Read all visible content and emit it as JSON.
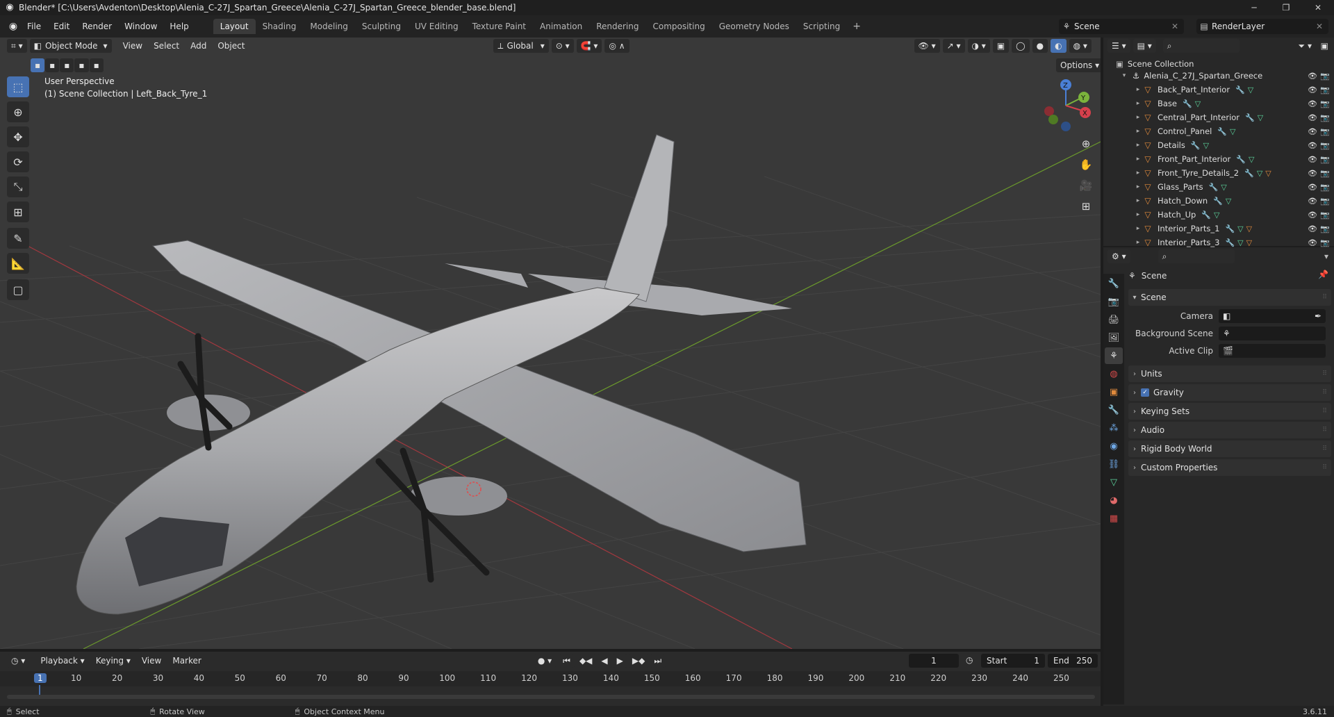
{
  "titlebar": {
    "title": "Blender* [C:\\Users\\Avdenton\\Desktop\\Alenia_C-27J_Spartan_Greece\\Alenia_C-27J_Spartan_Greece_blender_base.blend]",
    "min": "─",
    "max": "❐",
    "close": "✕"
  },
  "menu": [
    "File",
    "Edit",
    "Render",
    "Window",
    "Help"
  ],
  "workspaces": [
    "Layout",
    "Shading",
    "Modeling",
    "Sculpting",
    "UV Editing",
    "Texture Paint",
    "Animation",
    "Rendering",
    "Compositing",
    "Geometry Nodes",
    "Scripting"
  ],
  "scene_name": "Scene",
  "view_layer": "RenderLayer",
  "viewport": {
    "mode": "Object Mode",
    "menus": [
      "View",
      "Select",
      "Add",
      "Object"
    ],
    "orientation": "Global",
    "options": "Options",
    "perspective": "User Perspective",
    "context": "(1) Scene Collection | Left_Back_Tyre_1",
    "gizmo": {
      "x": "X",
      "y": "Y",
      "z": "Z"
    }
  },
  "outliner": {
    "root": "Scene Collection",
    "collection": "Alenia_C_27J_Spartan_Greece",
    "items": [
      {
        "name": "Back_Part_Interior",
        "mat": false
      },
      {
        "name": "Base",
        "mat": false
      },
      {
        "name": "Central_Part_Interior",
        "mat": false
      },
      {
        "name": "Control_Panel",
        "mat": false
      },
      {
        "name": "Details",
        "mat": false
      },
      {
        "name": "Front_Part_Interior",
        "mat": false
      },
      {
        "name": "Front_Tyre_Details_2",
        "mat": true
      },
      {
        "name": "Glass_Parts",
        "mat": false
      },
      {
        "name": "Hatch_Down",
        "mat": false
      },
      {
        "name": "Hatch_Up",
        "mat": false
      },
      {
        "name": "Interior_Parts_1",
        "mat": true
      },
      {
        "name": "Interior_Parts_3",
        "mat": true
      }
    ]
  },
  "properties": {
    "context": "Scene",
    "panel": "Scene",
    "camera_label": "Camera",
    "bg_label": "Background Scene",
    "clip_label": "Active Clip",
    "subpanels": [
      "Units",
      "Gravity",
      "Keying Sets",
      "Audio",
      "Rigid Body World",
      "Custom Properties"
    ]
  },
  "timeline": {
    "menus": [
      "Playback",
      "Keying",
      "View",
      "Marker"
    ],
    "current_frame": "1",
    "start_label": "Start",
    "start": "1",
    "end_label": "End",
    "end": "250",
    "ticks": [
      "1",
      "10",
      "20",
      "30",
      "40",
      "50",
      "60",
      "70",
      "80",
      "90",
      "100",
      "110",
      "120",
      "130",
      "140",
      "150",
      "160",
      "170",
      "180",
      "190",
      "200",
      "210",
      "220",
      "230",
      "240",
      "250"
    ]
  },
  "status": {
    "select": "Select",
    "rotate": "Rotate View",
    "context_menu": "Object Context Menu",
    "version": "3.6.11"
  },
  "colors": {
    "accent": "#4772b3",
    "object_orange": "#e08a3c",
    "mesh_green": "#5cd39c",
    "modifier_blue": "#6fa8e6"
  }
}
